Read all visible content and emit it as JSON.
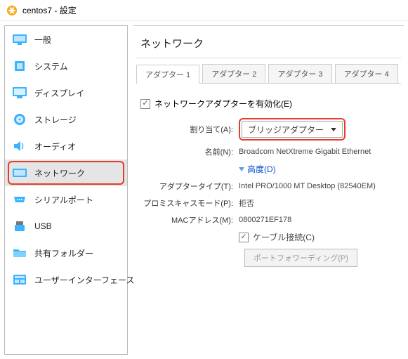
{
  "titlebar": {
    "title": "centos7 - 設定"
  },
  "sidebar": {
    "items": [
      {
        "label": "一般"
      },
      {
        "label": "システム"
      },
      {
        "label": "ディスプレイ"
      },
      {
        "label": "ストレージ"
      },
      {
        "label": "オーディオ"
      },
      {
        "label": "ネットワーク"
      },
      {
        "label": "シリアルポート"
      },
      {
        "label": "USB"
      },
      {
        "label": "共有フォルダー"
      },
      {
        "label": "ユーザーインターフェース"
      }
    ],
    "selected_index": 5
  },
  "content": {
    "title": "ネットワーク",
    "tabs": [
      "アダプター 1",
      "アダプター 2",
      "アダプター 3",
      "アダプター 4"
    ],
    "active_tab": 0,
    "enable": {
      "label": "ネットワークアダプターを有効化(E)",
      "checked": true
    },
    "fields": {
      "attached": {
        "label": "割り当て(A):",
        "value": "ブリッジアダプター"
      },
      "name": {
        "label": "名前(N):",
        "value": "Broadcom NetXtreme Gigabit Ethernet"
      },
      "advanced": {
        "label": "高度(D)"
      },
      "adapter_type": {
        "label": "アダプタータイプ(T):",
        "value": "Intel PRO/1000 MT Desktop (82540EM)"
      },
      "promisc": {
        "label": "プロミスキャスモード(P):",
        "value": "拒否"
      },
      "mac": {
        "label": "MACアドレス(M):",
        "value": "0800271EF178"
      },
      "cable": {
        "label": "ケーブル接続(C)",
        "checked": true
      },
      "port_fwd": {
        "label": "ポートフォワーディング(P)"
      }
    }
  },
  "colors": {
    "accent": "#3ab4ff",
    "highlight": "#e63b2f"
  }
}
